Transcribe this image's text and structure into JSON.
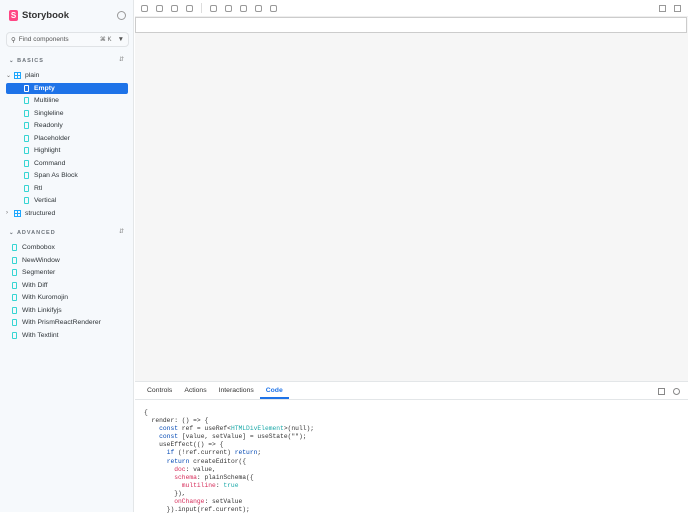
{
  "app": {
    "title": "Storybook",
    "logo_letter": "S"
  },
  "search": {
    "placeholder": "Find components",
    "shortcut": "⌘ K"
  },
  "sections": [
    {
      "label": "BASICS",
      "groups": [
        {
          "label": "plain",
          "items": [
            "Empty",
            "Multiline",
            "Singleline",
            "Readonly",
            "Placeholder",
            "Highlight",
            "Command",
            "Span As Block",
            "Rtl",
            "Vertical"
          ],
          "selected": "Empty"
        },
        {
          "label": "structured"
        }
      ]
    },
    {
      "label": "ADVANCED",
      "items": [
        "Combobox",
        "NewWindow",
        "Segmenter",
        "With Diff",
        "With Kuromojin",
        "With Linkifyjs",
        "With PrismReactRenderer",
        "With Textlint"
      ]
    }
  ],
  "panel": {
    "tabs": [
      "Controls",
      "Actions",
      "Interactions",
      "Code"
    ],
    "active_tab": "Code"
  },
  "code": {
    "lines": [
      "{",
      "  render: () => {",
      "    const ref = useRef<HTMLDivElement>(null);",
      "    const [value, setValue] = useState(\"\");",
      "    useEffect(() => {",
      "      if (!ref.current) return;",
      "      return createEditor({",
      "        doc: value,",
      "        schema: plainSchema({",
      "          multiline: true",
      "        }),",
      "        onChange: setValue",
      "      }).input(ref.current);"
    ]
  },
  "colors": {
    "accent": "#1e73e8",
    "brand": "#ff4785",
    "story_icon": "#37d5d3"
  }
}
